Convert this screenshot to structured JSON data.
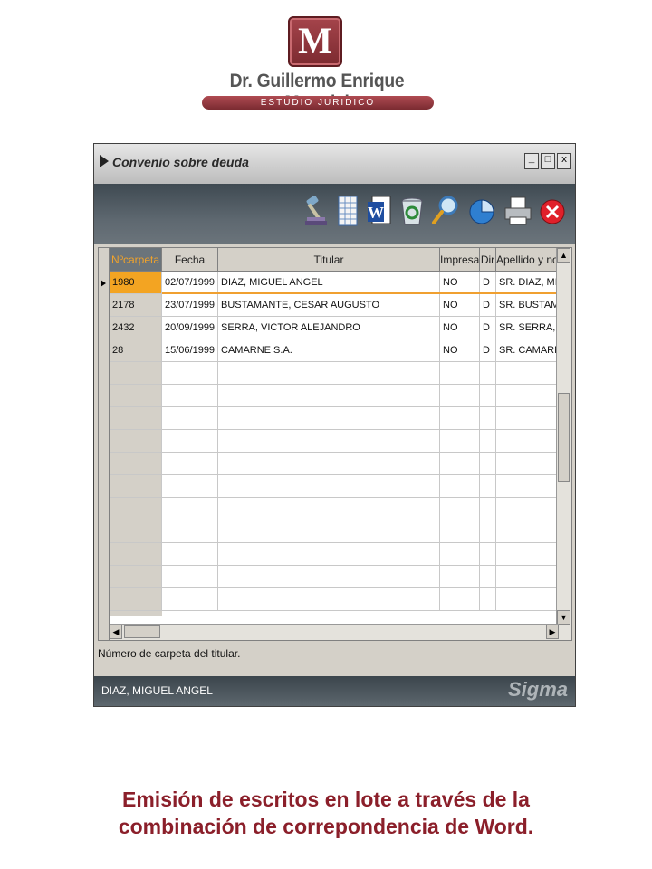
{
  "logo": {
    "letter": "M",
    "name": "Dr. Guillermo Enrique Maradei",
    "subtitle": "ESTUDIO JURIDICO",
    "brand_color": "#8b2d33"
  },
  "window": {
    "title": "Convenio sobre deuda",
    "controls": [
      "_",
      "□",
      "x"
    ],
    "toolbar_icons": [
      "gavel-icon",
      "spreadsheet-icon",
      "word-icon",
      "recycle-bin-icon",
      "search-icon",
      "pie-chart-icon",
      "printer-icon",
      "close-icon"
    ]
  },
  "grid": {
    "columns": [
      "Nºcarpeta",
      "Fecha",
      "Titular",
      "Impresa",
      "Dir",
      "Apellido y nom"
    ],
    "rows": [
      [
        "1980",
        "02/07/1999",
        "DIAZ, MIGUEL ANGEL",
        "NO",
        "D",
        "SR. DIAZ, MIG"
      ],
      [
        "2178",
        "23/07/1999",
        "BUSTAMANTE, CESAR AUGUSTO",
        "NO",
        "D",
        "SR. BUSTAMA"
      ],
      [
        "2432",
        "20/09/1999",
        "SERRA, VICTOR ALEJANDRO",
        "NO",
        "D",
        "SR. SERRA, V"
      ],
      [
        "28",
        "15/06/1999",
        "CAMARNE S.A.",
        "NO",
        "D",
        "SR. CAMARNE"
      ]
    ],
    "selected_row": 0,
    "highlight_color": "#f3a422"
  },
  "status": {
    "hint": "Número de carpeta del titular.",
    "current_name": "DIAZ, MIGUEL ANGEL",
    "brand": "Sigma"
  },
  "caption": {
    "line1": "Emisión de escritos en lote a través de la",
    "line2": "combinación de correpondencia de Word."
  }
}
